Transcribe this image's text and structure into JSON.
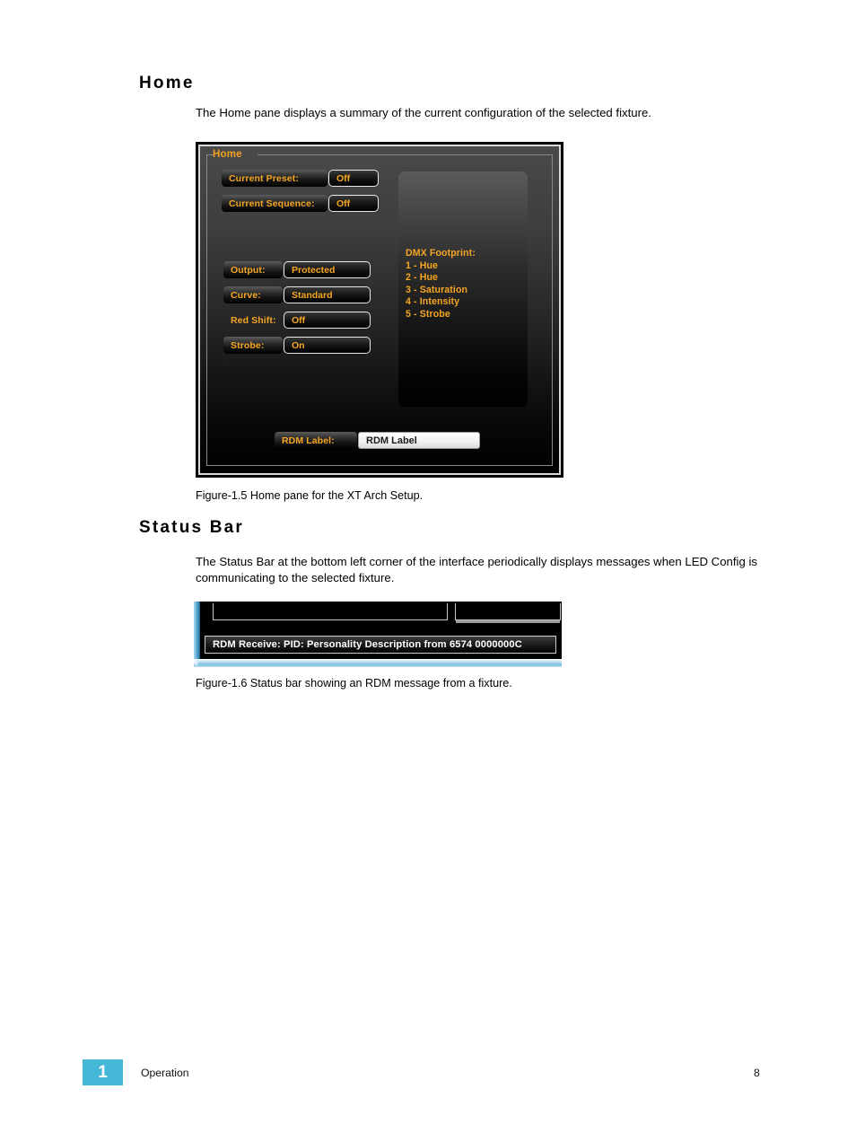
{
  "document": {
    "sections": [
      {
        "heading": "Home",
        "intro": "The Home pane displays a summary of the current configuration of the selected fixture.",
        "caption": "Figure-1.5 Home pane for the XT Arch Setup."
      },
      {
        "heading": "Status Bar",
        "intro": "The Status Bar at the bottom left corner of the interface periodically displays messages when LED Config is communicating to the selected fixture.",
        "caption": "Figure-1.6 Status bar showing an RDM message from a fixture."
      }
    ]
  },
  "home_pane": {
    "groupbox_legend": "Home",
    "rows": [
      {
        "label": "Current Preset:",
        "value": "Off"
      },
      {
        "label": "Current Sequence:",
        "value": "Off"
      },
      {
        "label": "Output:",
        "value": "Protected"
      },
      {
        "label": "Curve:",
        "value": "Standard"
      },
      {
        "label": "Red Shift:",
        "value": "Off"
      },
      {
        "label": "Strobe:",
        "value": "On"
      }
    ],
    "dmx_footprint": {
      "title": "DMX Footprint:",
      "channels": [
        "1 - Hue",
        "2 - Hue",
        "3 - Saturation",
        "4 - Intensity",
        "5 - Strobe"
      ],
      "text": "DMX Footprint:\n1 - Hue\n2 - Hue\n3 - Saturation\n4 - Intensity\n5 - Strobe"
    },
    "rdm_label": {
      "label": "RDM Label:",
      "value": "RDM Label"
    },
    "colors": {
      "accent_amber": "#f5a623",
      "pane_background": "#3d3d3d",
      "border": "#d8d8d8"
    }
  },
  "status_bar_figure": {
    "message": "RDM Receive: PID: Personality Description from 6574 0000000C",
    "chrome_color": "#7cc0e0"
  },
  "footer": {
    "chapter_number": "1",
    "section_label": "Operation",
    "page_number": "8",
    "badge_color": "#45b8d8"
  }
}
